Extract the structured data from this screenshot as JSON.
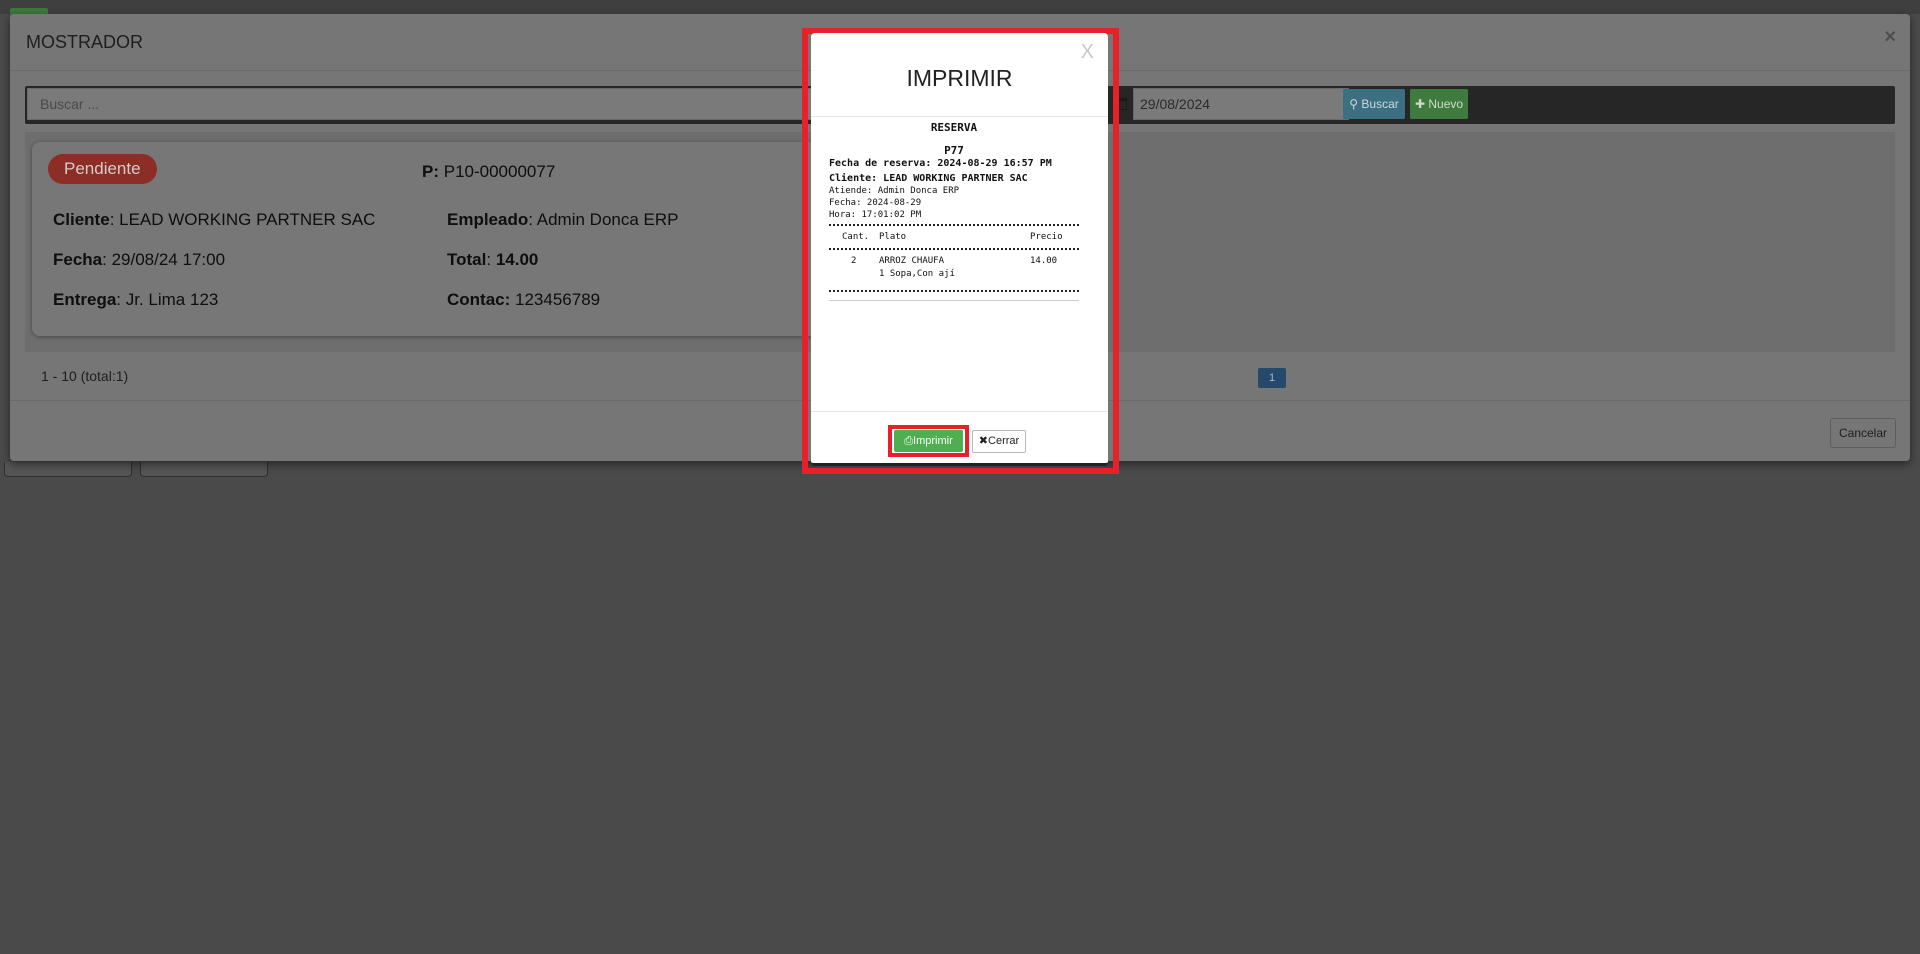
{
  "mostrador": {
    "title": "MOSTRADOR",
    "close_glyph": "×",
    "search_placeholder": "Buscar ...",
    "date_value": "29/08/2024",
    "buscar_label": "Buscar",
    "nuevo_label": "Nuevo",
    "cancelar_label": "Cancelar",
    "pager_text": "1 - 10 (total:1)",
    "current_page": "1",
    "order": {
      "status": "Pendiente",
      "p_label": "P:",
      "p_value": "P10-00000077",
      "cliente_label": "Cliente",
      "cliente_value": ": LEAD WORKING PARTNER SAC",
      "empleado_label": "Empleado",
      "empleado_value": ": Admin Donca ERP",
      "fecha_label": "Fecha",
      "fecha_value": ": 29/08/24 17:00",
      "total_label": "Total",
      "total_value": "14.00",
      "entrega_label": "Entrega",
      "entrega_value": ": Jr. Lima 123",
      "contac_label": "Contac:",
      "contac_value": "123456789"
    }
  },
  "print_dialog": {
    "title": "IMPRIMIR",
    "close_glyph": "X",
    "receipt": {
      "heading": "RESERVA",
      "code": "P77",
      "fecha_reserva": "Fecha de reserva: 2024-08-29 16:57 PM",
      "cliente": "Cliente: LEAD WORKING PARTNER SAC",
      "atiende": "Atiende: Admin Donca ERP",
      "fecha": "Fecha: 2024-08-29",
      "hora": "Hora: 17:01:02 PM",
      "columns": [
        "Cant.",
        "Plato",
        "Precio"
      ],
      "items": [
        {
          "cant": "2",
          "plato": "ARROZ CHAUFA",
          "precio": "14.00",
          "note": "1 Sopa,Con ají"
        }
      ]
    },
    "imprimir_label": "Imprimir",
    "cerrar_label": "Cerrar"
  },
  "colors": {
    "overlay": "#4a4a4a",
    "highlight": "#e8202a",
    "imprimir_green": "#4fae4f"
  }
}
